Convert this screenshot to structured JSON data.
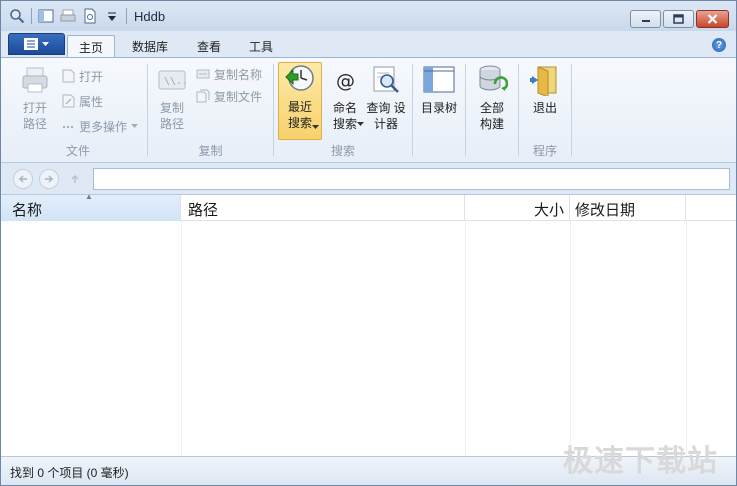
{
  "window": {
    "title": "Hddb"
  },
  "tabs": [
    {
      "label": "主页",
      "active": true
    },
    {
      "label": "数据库",
      "active": false
    },
    {
      "label": "查看",
      "active": false
    },
    {
      "label": "工具",
      "active": false
    }
  ],
  "ribbon": {
    "file": {
      "label": "文件",
      "open_path": "打开\n路径",
      "open": "打开",
      "properties": "属性",
      "more_actions": "更多操作"
    },
    "copy": {
      "label": "复制",
      "copy_path": "复制\n路径",
      "copy_name": "复制名称",
      "copy_file": "复制文件"
    },
    "search": {
      "label": "搜索",
      "recent_search": "最近\n搜索",
      "name_search": "命名\n搜索",
      "query_designer": "查询 设\n计器"
    },
    "directory_tree": "目录树",
    "rebuild": {
      "text": "全部\n构建"
    },
    "program": {
      "label": "程序",
      "exit": "退出"
    }
  },
  "columns": [
    {
      "label": "名称",
      "sorted": true
    },
    {
      "label": "路径"
    },
    {
      "label": "大小"
    },
    {
      "label": "修改日期"
    }
  ],
  "status": {
    "text": "找到 0 个项目 (0 毫秒)"
  },
  "watermark": "极速下载站",
  "colors": {
    "accent": "#1b4b98",
    "selected": "#f8d16c",
    "disabled_text": "#8f9aa8"
  }
}
